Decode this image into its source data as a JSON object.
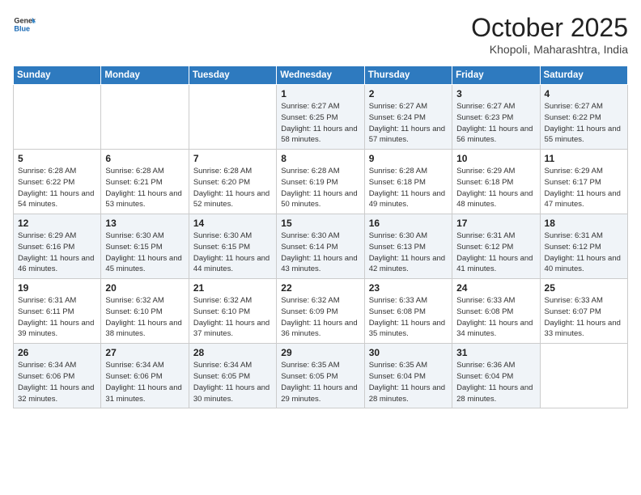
{
  "header": {
    "logo_line1": "General",
    "logo_line2": "Blue",
    "month": "October 2025",
    "location": "Khopoli, Maharashtra, India"
  },
  "weekdays": [
    "Sunday",
    "Monday",
    "Tuesday",
    "Wednesday",
    "Thursday",
    "Friday",
    "Saturday"
  ],
  "weeks": [
    [
      {
        "day": "",
        "sunrise": "",
        "sunset": "",
        "daylight": ""
      },
      {
        "day": "",
        "sunrise": "",
        "sunset": "",
        "daylight": ""
      },
      {
        "day": "",
        "sunrise": "",
        "sunset": "",
        "daylight": ""
      },
      {
        "day": "1",
        "sunrise": "Sunrise: 6:27 AM",
        "sunset": "Sunset: 6:25 PM",
        "daylight": "Daylight: 11 hours and 58 minutes."
      },
      {
        "day": "2",
        "sunrise": "Sunrise: 6:27 AM",
        "sunset": "Sunset: 6:24 PM",
        "daylight": "Daylight: 11 hours and 57 minutes."
      },
      {
        "day": "3",
        "sunrise": "Sunrise: 6:27 AM",
        "sunset": "Sunset: 6:23 PM",
        "daylight": "Daylight: 11 hours and 56 minutes."
      },
      {
        "day": "4",
        "sunrise": "Sunrise: 6:27 AM",
        "sunset": "Sunset: 6:22 PM",
        "daylight": "Daylight: 11 hours and 55 minutes."
      }
    ],
    [
      {
        "day": "5",
        "sunrise": "Sunrise: 6:28 AM",
        "sunset": "Sunset: 6:22 PM",
        "daylight": "Daylight: 11 hours and 54 minutes."
      },
      {
        "day": "6",
        "sunrise": "Sunrise: 6:28 AM",
        "sunset": "Sunset: 6:21 PM",
        "daylight": "Daylight: 11 hours and 53 minutes."
      },
      {
        "day": "7",
        "sunrise": "Sunrise: 6:28 AM",
        "sunset": "Sunset: 6:20 PM",
        "daylight": "Daylight: 11 hours and 52 minutes."
      },
      {
        "day": "8",
        "sunrise": "Sunrise: 6:28 AM",
        "sunset": "Sunset: 6:19 PM",
        "daylight": "Daylight: 11 hours and 50 minutes."
      },
      {
        "day": "9",
        "sunrise": "Sunrise: 6:28 AM",
        "sunset": "Sunset: 6:18 PM",
        "daylight": "Daylight: 11 hours and 49 minutes."
      },
      {
        "day": "10",
        "sunrise": "Sunrise: 6:29 AM",
        "sunset": "Sunset: 6:18 PM",
        "daylight": "Daylight: 11 hours and 48 minutes."
      },
      {
        "day": "11",
        "sunrise": "Sunrise: 6:29 AM",
        "sunset": "Sunset: 6:17 PM",
        "daylight": "Daylight: 11 hours and 47 minutes."
      }
    ],
    [
      {
        "day": "12",
        "sunrise": "Sunrise: 6:29 AM",
        "sunset": "Sunset: 6:16 PM",
        "daylight": "Daylight: 11 hours and 46 minutes."
      },
      {
        "day": "13",
        "sunrise": "Sunrise: 6:30 AM",
        "sunset": "Sunset: 6:15 PM",
        "daylight": "Daylight: 11 hours and 45 minutes."
      },
      {
        "day": "14",
        "sunrise": "Sunrise: 6:30 AM",
        "sunset": "Sunset: 6:15 PM",
        "daylight": "Daylight: 11 hours and 44 minutes."
      },
      {
        "day": "15",
        "sunrise": "Sunrise: 6:30 AM",
        "sunset": "Sunset: 6:14 PM",
        "daylight": "Daylight: 11 hours and 43 minutes."
      },
      {
        "day": "16",
        "sunrise": "Sunrise: 6:30 AM",
        "sunset": "Sunset: 6:13 PM",
        "daylight": "Daylight: 11 hours and 42 minutes."
      },
      {
        "day": "17",
        "sunrise": "Sunrise: 6:31 AM",
        "sunset": "Sunset: 6:12 PM",
        "daylight": "Daylight: 11 hours and 41 minutes."
      },
      {
        "day": "18",
        "sunrise": "Sunrise: 6:31 AM",
        "sunset": "Sunset: 6:12 PM",
        "daylight": "Daylight: 11 hours and 40 minutes."
      }
    ],
    [
      {
        "day": "19",
        "sunrise": "Sunrise: 6:31 AM",
        "sunset": "Sunset: 6:11 PM",
        "daylight": "Daylight: 11 hours and 39 minutes."
      },
      {
        "day": "20",
        "sunrise": "Sunrise: 6:32 AM",
        "sunset": "Sunset: 6:10 PM",
        "daylight": "Daylight: 11 hours and 38 minutes."
      },
      {
        "day": "21",
        "sunrise": "Sunrise: 6:32 AM",
        "sunset": "Sunset: 6:10 PM",
        "daylight": "Daylight: 11 hours and 37 minutes."
      },
      {
        "day": "22",
        "sunrise": "Sunrise: 6:32 AM",
        "sunset": "Sunset: 6:09 PM",
        "daylight": "Daylight: 11 hours and 36 minutes."
      },
      {
        "day": "23",
        "sunrise": "Sunrise: 6:33 AM",
        "sunset": "Sunset: 6:08 PM",
        "daylight": "Daylight: 11 hours and 35 minutes."
      },
      {
        "day": "24",
        "sunrise": "Sunrise: 6:33 AM",
        "sunset": "Sunset: 6:08 PM",
        "daylight": "Daylight: 11 hours and 34 minutes."
      },
      {
        "day": "25",
        "sunrise": "Sunrise: 6:33 AM",
        "sunset": "Sunset: 6:07 PM",
        "daylight": "Daylight: 11 hours and 33 minutes."
      }
    ],
    [
      {
        "day": "26",
        "sunrise": "Sunrise: 6:34 AM",
        "sunset": "Sunset: 6:06 PM",
        "daylight": "Daylight: 11 hours and 32 minutes."
      },
      {
        "day": "27",
        "sunrise": "Sunrise: 6:34 AM",
        "sunset": "Sunset: 6:06 PM",
        "daylight": "Daylight: 11 hours and 31 minutes."
      },
      {
        "day": "28",
        "sunrise": "Sunrise: 6:34 AM",
        "sunset": "Sunset: 6:05 PM",
        "daylight": "Daylight: 11 hours and 30 minutes."
      },
      {
        "day": "29",
        "sunrise": "Sunrise: 6:35 AM",
        "sunset": "Sunset: 6:05 PM",
        "daylight": "Daylight: 11 hours and 29 minutes."
      },
      {
        "day": "30",
        "sunrise": "Sunrise: 6:35 AM",
        "sunset": "Sunset: 6:04 PM",
        "daylight": "Daylight: 11 hours and 28 minutes."
      },
      {
        "day": "31",
        "sunrise": "Sunrise: 6:36 AM",
        "sunset": "Sunset: 6:04 PM",
        "daylight": "Daylight: 11 hours and 28 minutes."
      },
      {
        "day": "",
        "sunrise": "",
        "sunset": "",
        "daylight": ""
      }
    ]
  ]
}
